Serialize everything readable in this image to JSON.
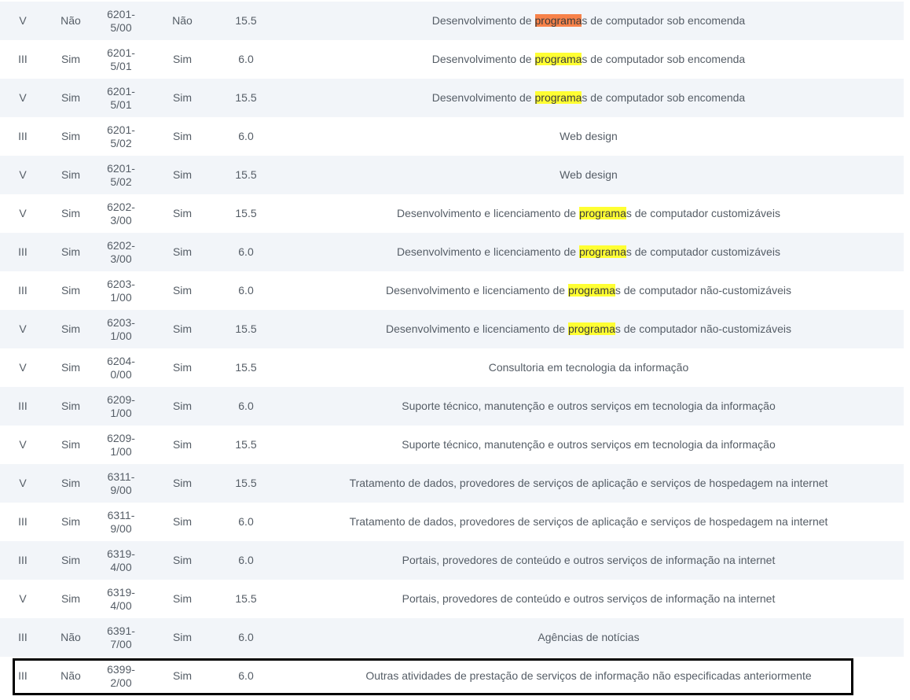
{
  "rows": [
    {
      "anexo": "V",
      "fator_r": "Não",
      "cnae_1": "6201-",
      "cnae_2": "5/00",
      "retencao": "Não",
      "aliquota": "15.5",
      "desc_pre": "Desenvolvimento de ",
      "desc_hl": "programa",
      "desc_post": "s de computador sob encomenda",
      "hl_current": true
    },
    {
      "anexo": "III",
      "fator_r": "Sim",
      "cnae_1": "6201-",
      "cnae_2": "5/01",
      "retencao": "Sim",
      "aliquota": "6.0",
      "desc_pre": "Desenvolvimento de ",
      "desc_hl": "programa",
      "desc_post": "s de computador sob encomenda"
    },
    {
      "anexo": "V",
      "fator_r": "Sim",
      "cnae_1": "6201-",
      "cnae_2": "5/01",
      "retencao": "Sim",
      "aliquota": "15.5",
      "desc_pre": "Desenvolvimento de ",
      "desc_hl": "programa",
      "desc_post": "s de computador sob encomenda"
    },
    {
      "anexo": "III",
      "fator_r": "Sim",
      "cnae_1": "6201-",
      "cnae_2": "5/02",
      "retencao": "Sim",
      "aliquota": "6.0",
      "desc_pre": "Web design",
      "desc_hl": "",
      "desc_post": ""
    },
    {
      "anexo": "V",
      "fator_r": "Sim",
      "cnae_1": "6201-",
      "cnae_2": "5/02",
      "retencao": "Sim",
      "aliquota": "15.5",
      "desc_pre": "Web design",
      "desc_hl": "",
      "desc_post": ""
    },
    {
      "anexo": "V",
      "fator_r": "Sim",
      "cnae_1": "6202-",
      "cnae_2": "3/00",
      "retencao": "Sim",
      "aliquota": "15.5",
      "desc_pre": "Desenvolvimento e licenciamento de ",
      "desc_hl": "programa",
      "desc_post": "s de computador customizáveis"
    },
    {
      "anexo": "III",
      "fator_r": "Sim",
      "cnae_1": "6202-",
      "cnae_2": "3/00",
      "retencao": "Sim",
      "aliquota": "6.0",
      "desc_pre": "Desenvolvimento e licenciamento de ",
      "desc_hl": "programa",
      "desc_post": "s de computador customizáveis"
    },
    {
      "anexo": "III",
      "fator_r": "Sim",
      "cnae_1": "6203-",
      "cnae_2": "1/00",
      "retencao": "Sim",
      "aliquota": "6.0",
      "desc_pre": "Desenvolvimento e licenciamento de ",
      "desc_hl": "programa",
      "desc_post": "s de computador não-customizáveis"
    },
    {
      "anexo": "V",
      "fator_r": "Sim",
      "cnae_1": "6203-",
      "cnae_2": "1/00",
      "retencao": "Sim",
      "aliquota": "15.5",
      "desc_pre": "Desenvolvimento e licenciamento de ",
      "desc_hl": "programa",
      "desc_post": "s de computador não-customizáveis"
    },
    {
      "anexo": "V",
      "fator_r": "Sim",
      "cnae_1": "6204-",
      "cnae_2": "0/00",
      "retencao": "Sim",
      "aliquota": "15.5",
      "desc_pre": "Consultoria em tecnologia da informação",
      "desc_hl": "",
      "desc_post": ""
    },
    {
      "anexo": "III",
      "fator_r": "Sim",
      "cnae_1": "6209-",
      "cnae_2": "1/00",
      "retencao": "Sim",
      "aliquota": "6.0",
      "desc_pre": "Suporte técnico, manutenção e outros serviços em tecnologia da informação",
      "desc_hl": "",
      "desc_post": ""
    },
    {
      "anexo": "V",
      "fator_r": "Sim",
      "cnae_1": "6209-",
      "cnae_2": "1/00",
      "retencao": "Sim",
      "aliquota": "15.5",
      "desc_pre": "Suporte técnico, manutenção e outros serviços em tecnologia da informação",
      "desc_hl": "",
      "desc_post": ""
    },
    {
      "anexo": "V",
      "fator_r": "Sim",
      "cnae_1": "6311-",
      "cnae_2": "9/00",
      "retencao": "Sim",
      "aliquota": "15.5",
      "desc_pre": "Tratamento de dados, provedores de serviços de aplicação e serviços de hospedagem na internet",
      "desc_hl": "",
      "desc_post": ""
    },
    {
      "anexo": "III",
      "fator_r": "Sim",
      "cnae_1": "6311-",
      "cnae_2": "9/00",
      "retencao": "Sim",
      "aliquota": "6.0",
      "desc_pre": "Tratamento de dados, provedores de serviços de aplicação e serviços de hospedagem na internet",
      "desc_hl": "",
      "desc_post": ""
    },
    {
      "anexo": "III",
      "fator_r": "Sim",
      "cnae_1": "6319-",
      "cnae_2": "4/00",
      "retencao": "Sim",
      "aliquota": "6.0",
      "desc_pre": "Portais, provedores de conteúdo e outros serviços de informação na internet",
      "desc_hl": "",
      "desc_post": ""
    },
    {
      "anexo": "V",
      "fator_r": "Sim",
      "cnae_1": "6319-",
      "cnae_2": "4/00",
      "retencao": "Sim",
      "aliquota": "15.5",
      "desc_pre": "Portais, provedores de conteúdo e outros serviços de informação na internet",
      "desc_hl": "",
      "desc_post": ""
    },
    {
      "anexo": "III",
      "fator_r": "Não",
      "cnae_1": "6391-",
      "cnae_2": "7/00",
      "retencao": "Sim",
      "aliquota": "6.0",
      "desc_pre": "Agências de notícias",
      "desc_hl": "",
      "desc_post": ""
    },
    {
      "anexo": "III",
      "fator_r": "Não",
      "cnae_1": "6399-",
      "cnae_2": "2/00",
      "retencao": "Sim",
      "aliquota": "6.0",
      "desc_pre": "Outras atividades de prestação de serviços de informação não especificadas anteriormente",
      "desc_hl": "",
      "desc_post": "",
      "selected": true
    }
  ],
  "colors": {
    "row_odd": "#f2f5f9",
    "row_even": "#ffffff",
    "text": "#555d66",
    "highlight": "#ffff33",
    "highlight_current": "#f7824a",
    "selection_border": "#000000"
  }
}
